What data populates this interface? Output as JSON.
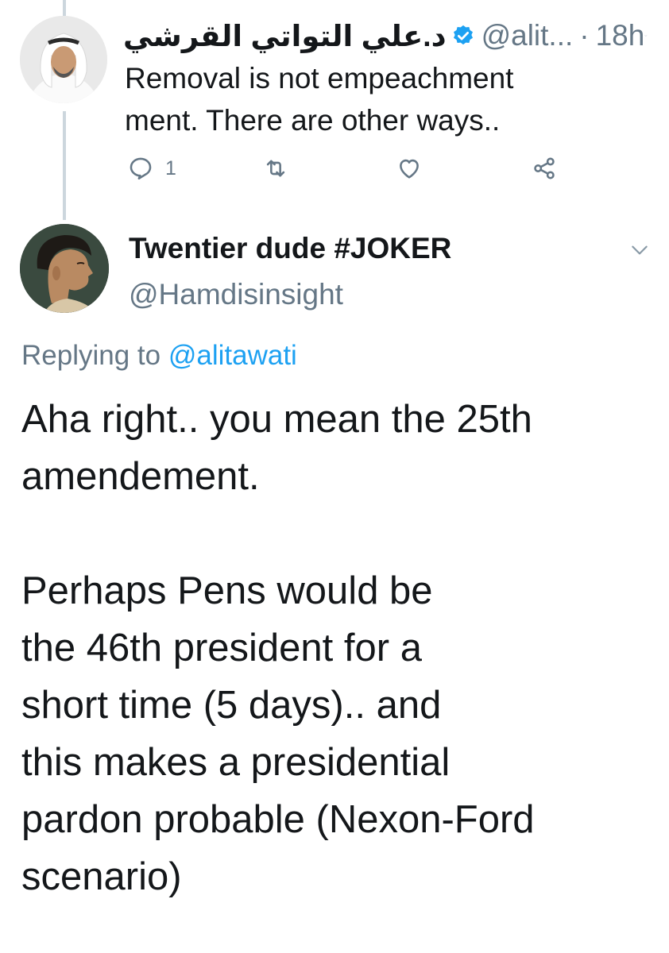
{
  "parent_tweet": {
    "display_name": "د.علي التواتي القرشي",
    "handle": "@alit...",
    "dot": "·",
    "time": "18h",
    "text": "Removal is not empeachment\nment. There are other ways..",
    "reply_count": "1",
    "icons": [
      "reply-icon",
      "retweet-icon",
      "like-icon",
      "share-icon"
    ],
    "verified": true
  },
  "reply_tweet": {
    "display_name": "Twentier dude #JOKER",
    "handle": "@Hamdisinsight",
    "replying_prefix": "Replying to",
    "replying_to": "@alitawati",
    "text": "Aha right.. you mean the 25th\namendement.\n\nPerhaps Pens would be\nthe 46th president for a\nshort time (5 days).. and\nthis makes a presidential\npardon probable (Nexon-Ford\nscenario)"
  },
  "colors": {
    "text": "#14171a",
    "secondary": "#657786",
    "link": "#1da1f2",
    "verified": "#1da1f2",
    "thread_line": "#ccd6dd"
  }
}
